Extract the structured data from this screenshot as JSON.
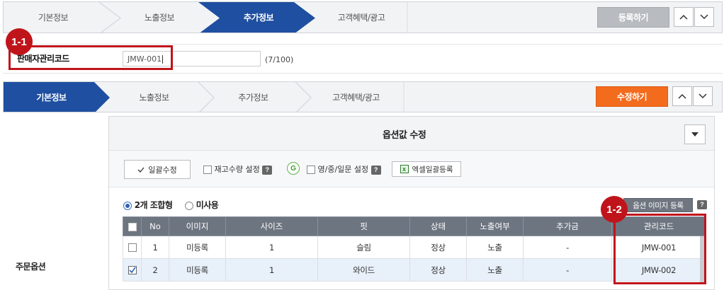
{
  "top_steps": [
    "기본정보",
    "노출정보",
    "추가정보",
    "고객혜택/광고"
  ],
  "top_active_step": "추가정보",
  "register_button": "등록하기",
  "badge_1": "1-1",
  "seller_code_label": "판매자관리코드",
  "seller_code_value": "JMW-001",
  "seller_code_count": "(7/100)",
  "second_steps": [
    "기본정보",
    "노출정보",
    "추가정보",
    "고객혜택/광고"
  ],
  "second_active_step": "기본정보",
  "edit_button": "수정하기",
  "order_option_label": "주문옵션",
  "option_panel_title": "옵션값 수정",
  "toolbar": {
    "bulk_edit": "일괄수정",
    "stock_setting": "재고수량 설정",
    "g_label": "G",
    "lang_setting": "영/중/일문 설정",
    "excel_register": "엑셀일괄등록"
  },
  "radio": {
    "combo": "2개 조합형",
    "unused": "미사용"
  },
  "option_image_button": "옵션 이미지 등록",
  "badge_2": "1-2",
  "table": {
    "headers": [
      "No",
      "이미지",
      "사이즈",
      "핏",
      "상태",
      "노출여부",
      "추가금",
      "관리코드"
    ],
    "rows": [
      {
        "no": "1",
        "image": "미등록",
        "size": "1",
        "fit": "슬림",
        "status": "정상",
        "display": "노출",
        "extra": "-",
        "code": "JMW-001",
        "checked": false
      },
      {
        "no": "2",
        "image": "미등록",
        "size": "1",
        "fit": "와이드",
        "status": "정상",
        "display": "노출",
        "extra": "-",
        "code": "JMW-002",
        "checked": true
      }
    ]
  },
  "colors": {
    "active_step": "#1f4fa0",
    "orange": "#f36b1c",
    "badge_red": "#c0141b",
    "header_gray": "#6d7581"
  },
  "icons": [
    "chevron-up-icon",
    "chevron-down-icon",
    "checkmark-icon",
    "help-icon",
    "excel-icon",
    "dropdown-icon"
  ]
}
